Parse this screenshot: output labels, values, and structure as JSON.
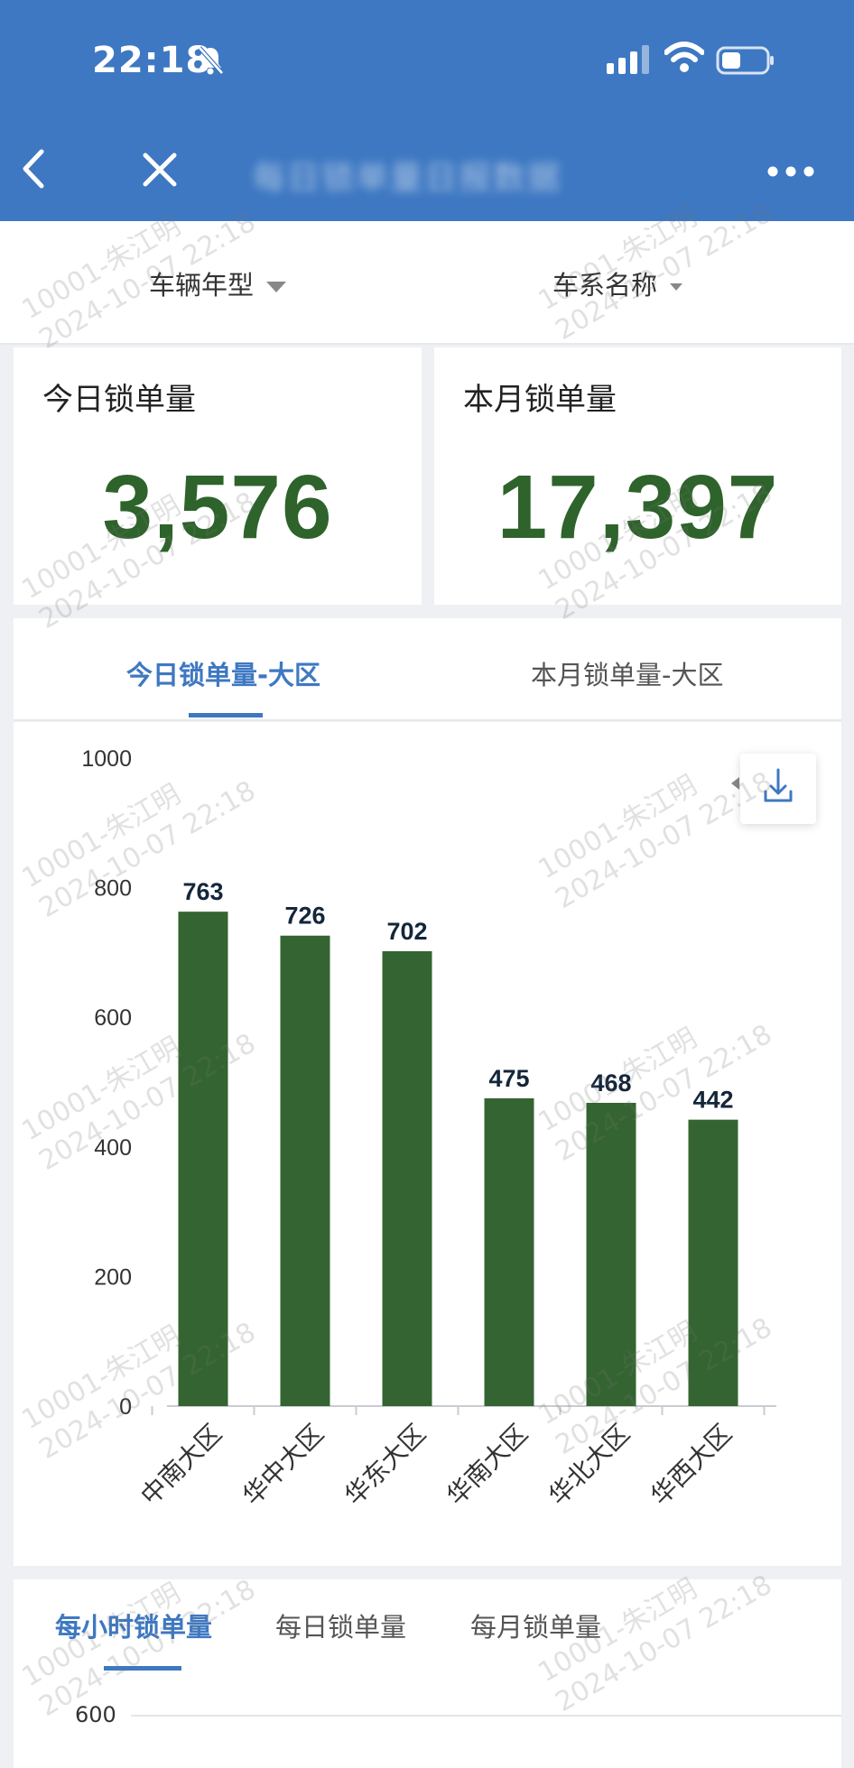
{
  "status_bar": {
    "time": "22:18"
  },
  "nav": {
    "title": "每日锁单量日报数据"
  },
  "filters": [
    {
      "label": "车辆年型"
    },
    {
      "label": "车系名称"
    }
  ],
  "kpi": {
    "today": {
      "title": "今日锁单量",
      "value": "3,576"
    },
    "month": {
      "title": "本月锁单量",
      "value": "17,397"
    }
  },
  "region_tabs": [
    {
      "label": "今日锁单量-大区",
      "active": true
    },
    {
      "label": "本月锁单量-大区",
      "active": false
    }
  ],
  "chart_data": {
    "type": "bar",
    "categories": [
      "中南大区",
      "华中大区",
      "华东大区",
      "华南大区",
      "华北大区",
      "华西大区"
    ],
    "values": [
      763,
      726,
      702,
      475,
      468,
      442
    ],
    "ylim": [
      0,
      1000
    ],
    "yticks": [
      0,
      200,
      400,
      600,
      800,
      1000
    ],
    "bar_color": "#346431",
    "grid": false,
    "title": "",
    "xlabel": "",
    "ylabel": ""
  },
  "bottom_tabs": [
    {
      "label": "每小时锁单量",
      "active": true
    },
    {
      "label": "每日锁单量",
      "active": false
    },
    {
      "label": "每月锁单量",
      "active": false
    }
  ],
  "next_chart": {
    "top_tick": "600"
  },
  "watermark": {
    "line1": "10001-朱江明",
    "line2": "2024-10-07 22:18"
  },
  "colors": {
    "header": "#3e78c2",
    "accent": "#3e78c2",
    "value_green": "#2e632b"
  }
}
